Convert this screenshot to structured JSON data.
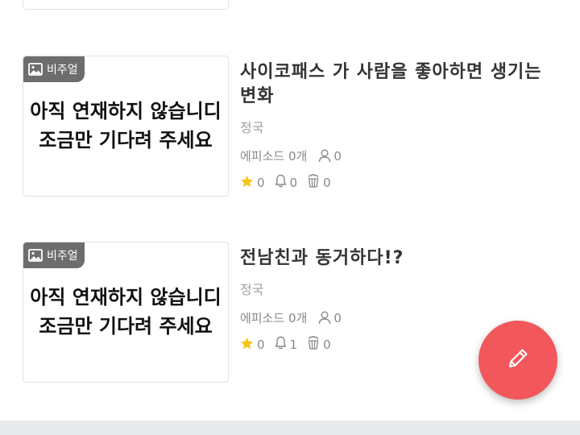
{
  "stories": [
    {
      "badge_label": "비주얼",
      "placeholder_line1": "아직 연재하지 않습니디",
      "placeholder_line2": "조금만 기다려 주세요",
      "title": "사이코패스 가 사람을 좋아하면 생기는 변화",
      "author": "정국",
      "episodes_label": "에피소드 0개",
      "subscribers": "0",
      "stars": "0",
      "notifications": "0",
      "popcorn": "0"
    },
    {
      "badge_label": "비주얼",
      "placeholder_line1": "아직 연재하지 않습니디",
      "placeholder_line2": "조금만 기다려 주세요",
      "title": "전남친과 동거하다!?",
      "author": "정국",
      "episodes_label": "에피소드 0개",
      "subscribers": "0",
      "stars": "0",
      "notifications": "1",
      "popcorn": "0"
    }
  ],
  "icons": {
    "image": "image-icon",
    "user": "user-icon",
    "star": "star-icon",
    "bell": "bell-icon",
    "popcorn": "popcorn-icon",
    "fab": "pencil-icon"
  },
  "colors": {
    "fab_background": "#f2575c",
    "star": "#f5c518",
    "badge_background": "#6d6d6d"
  }
}
